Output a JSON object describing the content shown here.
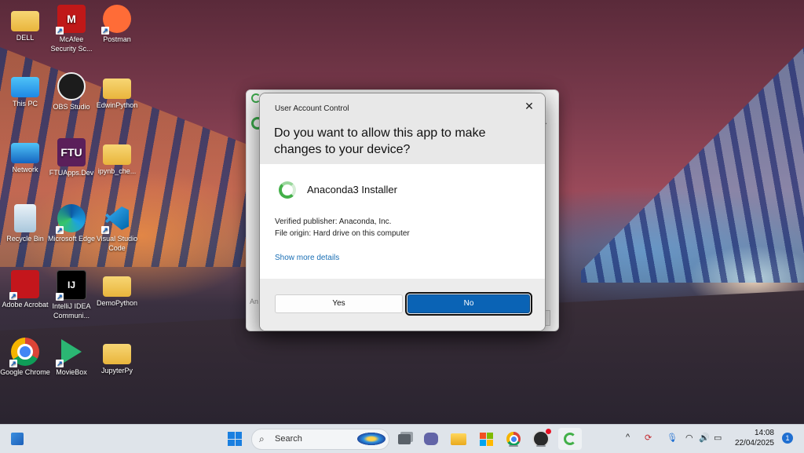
{
  "desktop": {
    "icons": [
      {
        "label": "DELL",
        "icon": "folder-icon"
      },
      {
        "label": "McAfee Security Sc...",
        "icon": "mcafee-icon"
      },
      {
        "label": "Postman",
        "icon": "postman-icon"
      },
      {
        "label": "This PC",
        "icon": "monitor-icon"
      },
      {
        "label": "OBS Studio",
        "icon": "obs-icon"
      },
      {
        "label": "EdwinPython",
        "icon": "folder-icon"
      },
      {
        "label": "Network",
        "icon": "network-icon"
      },
      {
        "label": "FTUApps.Dev",
        "icon": "ftu-icon"
      },
      {
        "label": "ipynb_che...",
        "icon": "folder-icon"
      },
      {
        "label": "Recycle Bin",
        "icon": "recycle-bin-icon"
      },
      {
        "label": "Microsoft Edge",
        "icon": "edge-icon"
      },
      {
        "label": "Visual Studio Code",
        "icon": "vscode-icon"
      },
      {
        "label": "Adobe Acrobat",
        "icon": "acrobat-icon"
      },
      {
        "label": "IntelliJ IDEA Communi...",
        "icon": "intellij-icon"
      },
      {
        "label": "DemoPython",
        "icon": "folder-icon"
      },
      {
        "label": "Google Chrome",
        "icon": "chrome-icon"
      },
      {
        "label": "MovieBox",
        "icon": "moviebox-icon"
      },
      {
        "label": "JupyterPy",
        "icon": "folder-icon"
      }
    ],
    "mcafee_glyph": "M",
    "ftu_glyph": "FTU",
    "intellij_glyph": "IJ",
    "shortcut_glyph": "↗"
  },
  "background_window": {
    "label_fragment": "An"
  },
  "uac": {
    "title": "User Account Control",
    "close_glyph": "✕",
    "question": "Do you want to allow this app to make changes to your device?",
    "app_name": "Anaconda3 Installer",
    "publisher": "Verified publisher: Anaconda, Inc.",
    "origin": "File origin: Hard drive on this computer",
    "more_link": "Show more details",
    "yes_label": "Yes",
    "no_label": "No",
    "accent": "#0a63b5"
  },
  "taskbar": {
    "search_placeholder": "Search",
    "time": "14:08",
    "date": "22/04/2025",
    "notification_count": "1",
    "caret_glyph": "^"
  }
}
